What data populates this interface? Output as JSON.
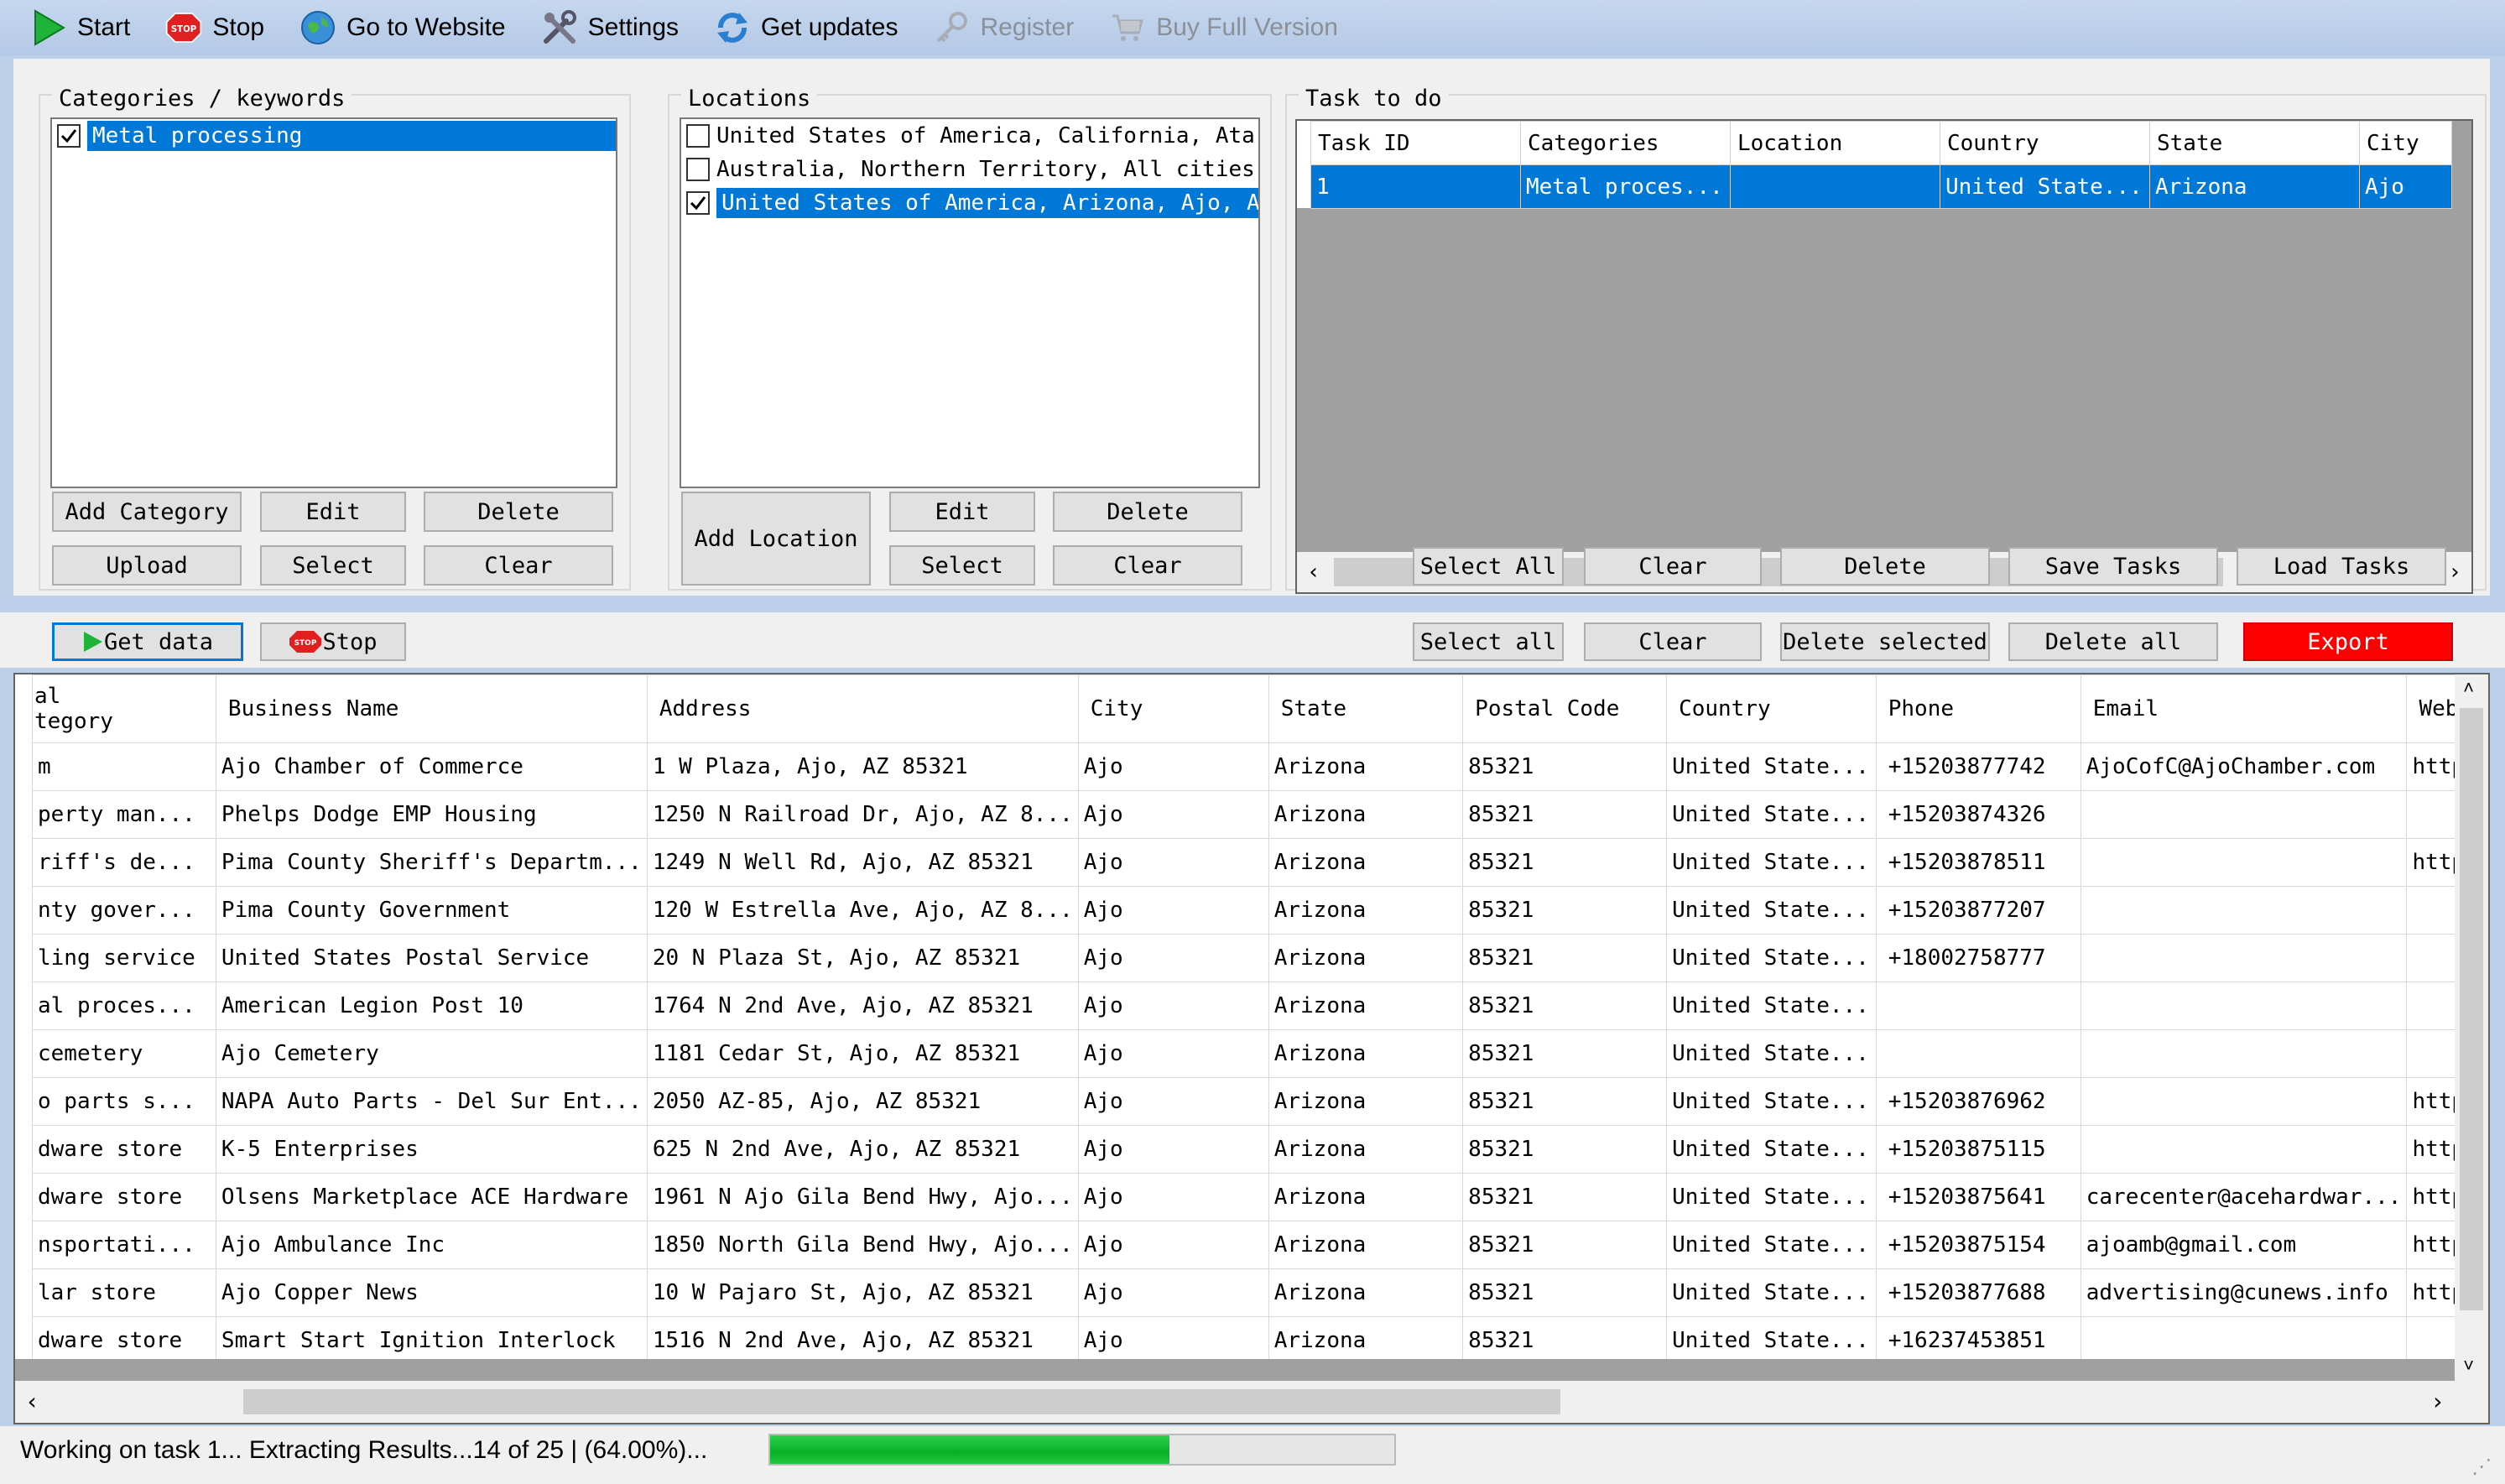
{
  "toolbar": {
    "start": "Start",
    "stop": "Stop",
    "website": "Go to Website",
    "settings": "Settings",
    "updates": "Get updates",
    "register": "Register",
    "buy": "Buy Full Version",
    "stop_icon_text": "STOP"
  },
  "categories": {
    "title": "Categories / keywords",
    "items": [
      {
        "label": "Metal processing",
        "checked": true,
        "selected": true
      }
    ],
    "add": "Add Category",
    "edit": "Edit",
    "delete": "Delete",
    "upload": "Upload",
    "select": "Select",
    "clear": "Clear"
  },
  "locations": {
    "title": "Locations",
    "items": [
      {
        "label": "United States of America, California, Ata:",
        "checked": false
      },
      {
        "label": "Australia, Northern Territory, All cities,",
        "checked": false
      },
      {
        "label": "United States of America, Arizona, Ajo, A",
        "checked": true
      }
    ],
    "add": "Add Location",
    "edit": "Edit",
    "delete": "Delete",
    "select": "Select",
    "clear": "Clear"
  },
  "tasks": {
    "title": "Task to do",
    "columns": [
      "Task ID",
      "Categories",
      "Location",
      "Country",
      "State",
      "City"
    ],
    "rows": [
      [
        "1",
        "Metal proces...",
        "",
        "United State...",
        "Arizona",
        "Ajo"
      ]
    ],
    "select_all": "Select All",
    "clear": "Clear",
    "delete": "Delete",
    "save": "Save Tasks",
    "load": "Load Tasks"
  },
  "actions": {
    "get_data": "Get data",
    "stop": "Stop",
    "select_all": "Select all",
    "clear": "Clear",
    "delete_selected": "Delete selected",
    "delete_all": "Delete all",
    "export": "Export"
  },
  "results": {
    "columns": [
      "al\ntegory",
      "Business Name",
      "Address",
      "City",
      "State",
      "Postal Code",
      "Country",
      "Phone",
      "Email",
      "Web"
    ],
    "rows": [
      [
        "m",
        "Ajo Chamber of Commerce",
        "1 W Plaza, Ajo, AZ 85321",
        "Ajo",
        "Arizona",
        "85321",
        "United State...",
        "+15203877742",
        "AjoCofC@AjoChamber.com",
        "http"
      ],
      [
        "perty man...",
        "Phelps Dodge EMP Housing",
        "1250 N Railroad Dr, Ajo, AZ 8...",
        "Ajo",
        "Arizona",
        "85321",
        "United State...",
        "+15203874326",
        "",
        ""
      ],
      [
        "riff's de...",
        "Pima County Sheriff's Departm...",
        "1249 N Well Rd, Ajo, AZ 85321",
        "Ajo",
        "Arizona",
        "85321",
        "United State...",
        "+15203878511",
        "",
        "http"
      ],
      [
        "nty gover...",
        "Pima County Government",
        "120 W Estrella Ave, Ajo, AZ 8...",
        "Ajo",
        "Arizona",
        "85321",
        "United State...",
        "+15203877207",
        "",
        ""
      ],
      [
        "ling service",
        "United States Postal Service",
        "20 N Plaza St, Ajo, AZ 85321",
        "Ajo",
        "Arizona",
        "85321",
        "United State...",
        "+18002758777",
        "",
        ""
      ],
      [
        "al proces...",
        "American Legion Post 10",
        "1764 N 2nd Ave, Ajo, AZ 85321",
        "Ajo",
        "Arizona",
        "85321",
        "United State...",
        "",
        "",
        ""
      ],
      [
        " cemetery",
        "Ajo Cemetery",
        "1181 Cedar St, Ajo, AZ 85321",
        "Ajo",
        "Arizona",
        "85321",
        "United State...",
        "",
        "",
        ""
      ],
      [
        "o parts s...",
        "NAPA Auto Parts - Del Sur Ent...",
        "2050 AZ-85, Ajo, AZ 85321",
        "Ajo",
        "Arizona",
        "85321",
        "United State...",
        "+15203876962",
        "",
        "http"
      ],
      [
        "dware store",
        "K-5 Enterprises",
        "625 N 2nd Ave, Ajo, AZ 85321",
        "Ajo",
        "Arizona",
        "85321",
        "United State...",
        "+15203875115",
        "",
        "http"
      ],
      [
        "dware store",
        "Olsens Marketplace ACE Hardware",
        "1961 N Ajo Gila Bend Hwy, Ajo...",
        "Ajo",
        "Arizona",
        "85321",
        "United State...",
        "+15203875641",
        "carecenter@acehardwar...",
        "http"
      ],
      [
        "nsportati...",
        "Ajo Ambulance Inc",
        "1850 North Gila Bend Hwy, Ajo...",
        "Ajo",
        "Arizona",
        "85321",
        "United State...",
        "+15203875154",
        "ajoamb@gmail.com",
        "http"
      ],
      [
        "lar store",
        "Ajo Copper News",
        "10 W Pajaro St, Ajo, AZ 85321",
        "Ajo",
        "Arizona",
        "85321",
        "United State...",
        "+15203877688",
        "advertising@cunews.info",
        "http"
      ],
      [
        "dware store",
        "Smart Start Ignition Interlock",
        "1516 N 2nd Ave, Ajo, AZ 85321",
        "Ajo",
        "Arizona",
        "85321",
        "United State...",
        "+16237453851",
        "",
        ""
      ]
    ]
  },
  "status": {
    "text": "Working on task 1... Extracting Results...14 of 25 | (64.00%)...",
    "progress": 0.64
  },
  "colors": {
    "selection": "#0078d7",
    "export": "#ff0000",
    "progress": "#06b025",
    "toolbar": "#bcd0ea"
  }
}
